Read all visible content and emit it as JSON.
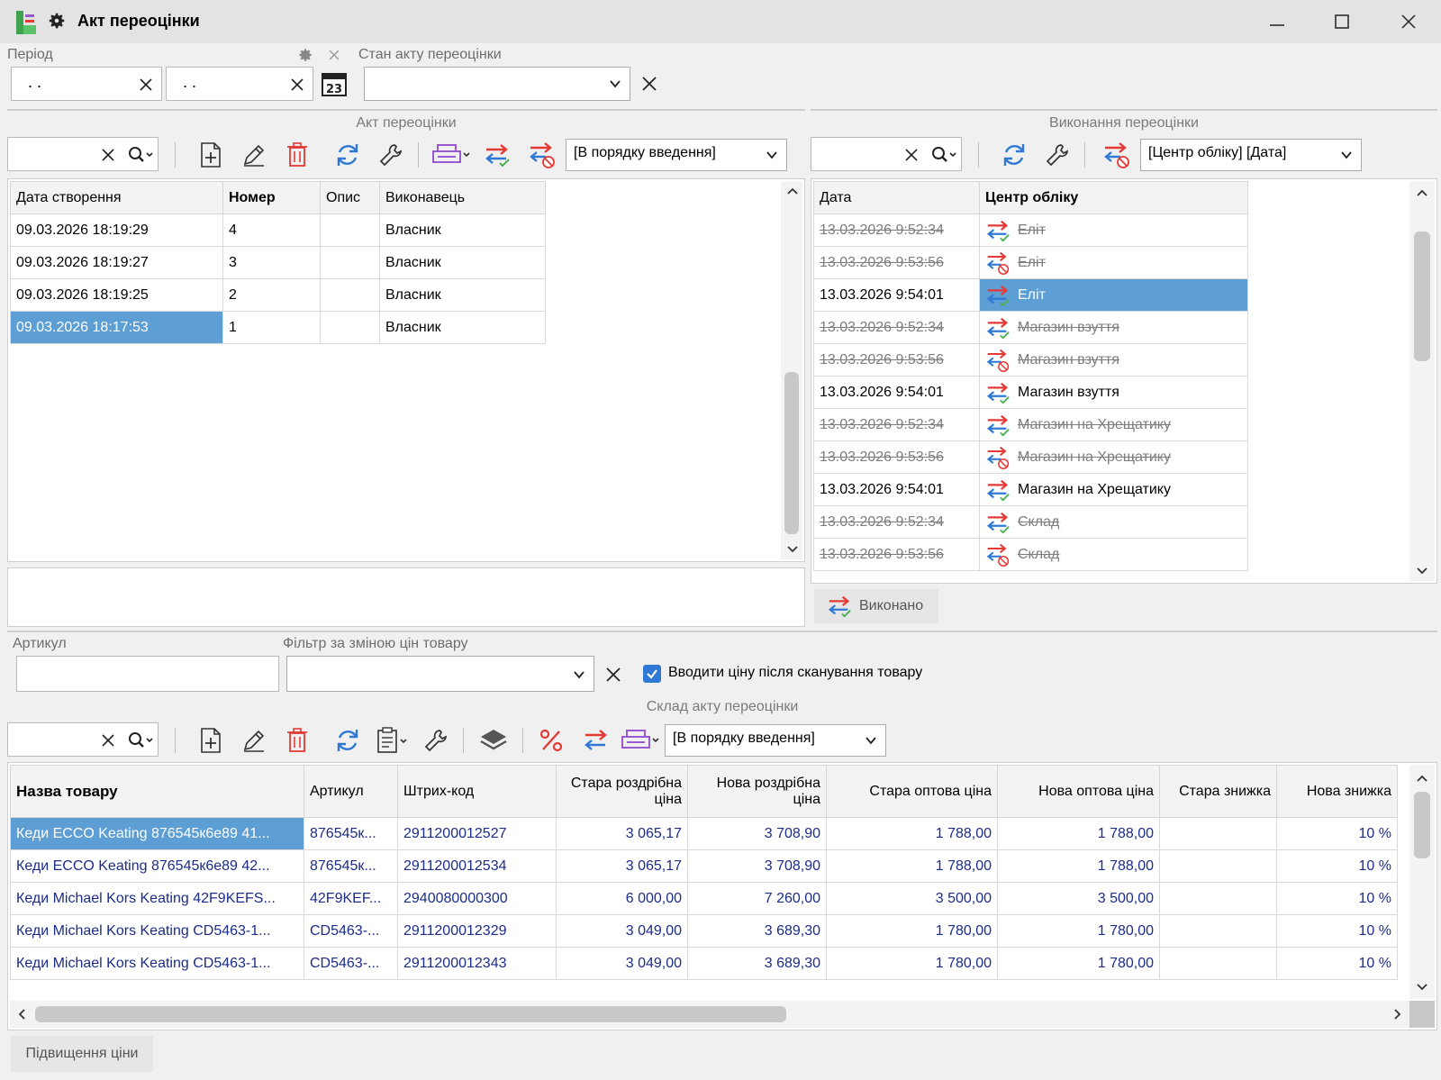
{
  "window": {
    "title": "Акт переоцінки"
  },
  "filters": {
    "period_label": "Період",
    "period_from": " .  .",
    "period_to": " .  .",
    "state_label": "Стан акту переоцінки",
    "state_value": ""
  },
  "acts": {
    "section_title": "Акт переоцінки",
    "search_value": "",
    "sort_option": "[В порядку введення]",
    "columns": [
      "Дата створення",
      "Номер",
      "Опис",
      "Виконавець"
    ],
    "rows": [
      {
        "date": "09.03.2026 18:19:29",
        "number": "4",
        "desc": "",
        "executor": "Власник"
      },
      {
        "date": "09.03.2026 18:19:27",
        "number": "3",
        "desc": "",
        "executor": "Власник"
      },
      {
        "date": "09.03.2026 18:19:25",
        "number": "2",
        "desc": "",
        "executor": "Власник"
      },
      {
        "date": "09.03.2026 18:17:53",
        "number": "1",
        "desc": "",
        "executor": "Власник"
      }
    ],
    "selected_row": 3
  },
  "execution": {
    "section_title": "Виконання переоцінки",
    "search_value": "",
    "sort_option": "[Центр обліку] [Дата]",
    "columns": [
      "Дата",
      "Центр обліку"
    ],
    "rows": [
      {
        "date": "13.03.2026 9:52:34",
        "center": "Еліт",
        "status": "applied",
        "active": false
      },
      {
        "date": "13.03.2026 9:53:56",
        "center": "Еліт",
        "status": "cancelled",
        "active": false
      },
      {
        "date": "13.03.2026 9:54:01",
        "center": "Еліт",
        "status": "applied",
        "active": true
      },
      {
        "date": "13.03.2026 9:52:34",
        "center": "Магазин взуття",
        "status": "applied",
        "active": false
      },
      {
        "date": "13.03.2026 9:53:56",
        "center": "Магазин взуття",
        "status": "cancelled",
        "active": false
      },
      {
        "date": "13.03.2026 9:54:01",
        "center": "Магазин взуття",
        "status": "applied",
        "active": true
      },
      {
        "date": "13.03.2026 9:52:34",
        "center": "Магазин на Хрещатику",
        "status": "applied",
        "active": false
      },
      {
        "date": "13.03.2026 9:53:56",
        "center": "Магазин на Хрещатику",
        "status": "cancelled",
        "active": false
      },
      {
        "date": "13.03.2026 9:54:01",
        "center": "Магазин на Хрещатику",
        "status": "applied",
        "active": true
      },
      {
        "date": "13.03.2026 9:52:34",
        "center": "Склад",
        "status": "applied",
        "active": false
      },
      {
        "date": "13.03.2026 9:53:56",
        "center": "Склад",
        "status": "cancelled",
        "active": false
      }
    ],
    "selected_row": 2,
    "done_button": "Виконано"
  },
  "goods_filter": {
    "article_label": "Артикул",
    "article_value": "",
    "price_filter_label": "Фільтр за зміною цін товару",
    "price_filter_value": "",
    "scan_checkbox_label": "Вводити ціну після сканування товару",
    "scan_checked": true
  },
  "goods": {
    "section_title": "Склад акту переоцінки",
    "search_value": "",
    "sort_option": "[В порядку введення]",
    "columns": [
      "Назва товару",
      "Артикул",
      "Штрих-код",
      "Стара роздрібна ціна",
      "Нова роздрібна ціна",
      "Стара оптова ціна",
      "Нова оптова ціна",
      "Стара знижка",
      "Нова знижка"
    ],
    "rows": [
      {
        "name": "Кеди ECCO Keating 876545к6е89 41...",
        "article": "876545к...",
        "barcode": "2911200012527",
        "old_retail": "3 065,17",
        "new_retail": "3 708,90",
        "old_wholesale": "1 788,00",
        "new_wholesale": "1 788,00",
        "old_discount": "",
        "new_discount": "10 %"
      },
      {
        "name": "Кеди ECCO Keating 876545к6е89 42...",
        "article": "876545к...",
        "barcode": "2911200012534",
        "old_retail": "3 065,17",
        "new_retail": "3 708,90",
        "old_wholesale": "1 788,00",
        "new_wholesale": "1 788,00",
        "old_discount": "",
        "new_discount": "10 %"
      },
      {
        "name": "Кеди Michael Kors Keating 42F9KEFS...",
        "article": "42F9KEF...",
        "barcode": "2940080000300",
        "old_retail": "6 000,00",
        "new_retail": "7 260,00",
        "old_wholesale": "3 500,00",
        "new_wholesale": "3 500,00",
        "old_discount": "",
        "new_discount": "10 %"
      },
      {
        "name": "Кеди Michael Kors Keating CD5463-1...",
        "article": "CD5463-...",
        "barcode": "2911200012329",
        "old_retail": "3 049,00",
        "new_retail": "3 689,30",
        "old_wholesale": "1 780,00",
        "new_wholesale": "1 780,00",
        "old_discount": "",
        "new_discount": "10 %"
      },
      {
        "name": "Кеди Michael Kors Keating CD5463-1...",
        "article": "CD5463-...",
        "barcode": "2911200012343",
        "old_retail": "3 049,00",
        "new_retail": "3 689,30",
        "old_wholesale": "1 780,00",
        "new_wholesale": "1 780,00",
        "old_discount": "",
        "new_discount": "10 %"
      }
    ],
    "selected_row": 0,
    "raise_price_button": "Підвищення ціни"
  },
  "colors": {
    "selection": "#5d9ed4",
    "goods_text": "#1b2c8a",
    "arrow_red": "#e53935",
    "arrow_blue": "#2f79d5",
    "check_green": "#4caf50"
  }
}
